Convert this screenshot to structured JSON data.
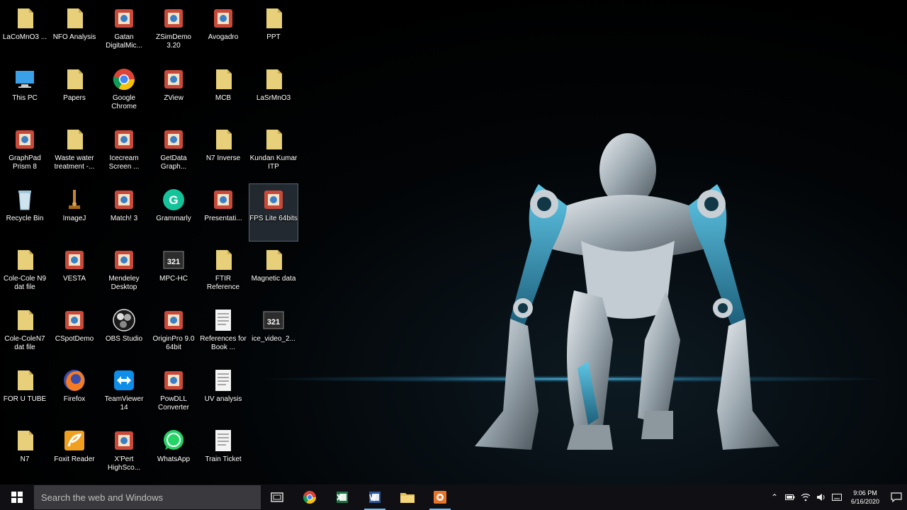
{
  "desktop": {
    "icons": [
      {
        "label": "LaCoMnO3 ...",
        "icon": "folder-icon"
      },
      {
        "label": "NFO Analysis",
        "icon": "folder-icon"
      },
      {
        "label": "Gatan DigitalMic...",
        "icon": "app-icon"
      },
      {
        "label": "ZSimDemo 3.20",
        "icon": "app-icon"
      },
      {
        "label": "Avogadro",
        "icon": "app-icon"
      },
      {
        "label": "PPT",
        "icon": "folder-icon"
      },
      {
        "label": "This PC",
        "icon": "computer-icon"
      },
      {
        "label": "Papers",
        "icon": "folder-icon"
      },
      {
        "label": "Google Chrome",
        "icon": "chrome-icon"
      },
      {
        "label": "ZView",
        "icon": "app-icon"
      },
      {
        "label": "MCB",
        "icon": "folder-icon"
      },
      {
        "label": "LaSrMnO3",
        "icon": "folder-icon"
      },
      {
        "label": "GraphPad Prism 8",
        "icon": "app-icon"
      },
      {
        "label": "Waste water treatment -...",
        "icon": "folder-icon"
      },
      {
        "label": "Icecream Screen ...",
        "icon": "app-icon"
      },
      {
        "label": "GetData Graph...",
        "icon": "app-icon"
      },
      {
        "label": "N7 Inverse",
        "icon": "folder-icon"
      },
      {
        "label": "Kundan Kumar ITP",
        "icon": "folder-icon"
      },
      {
        "label": "Recycle Bin",
        "icon": "recycle-bin-icon"
      },
      {
        "label": "ImageJ",
        "icon": "microscope-icon"
      },
      {
        "label": "Match! 3",
        "icon": "app-icon"
      },
      {
        "label": "Grammarly",
        "icon": "grammarly-icon"
      },
      {
        "label": "Presentati...",
        "icon": "app-icon"
      },
      {
        "label": "FPS Lite 64bits",
        "icon": "app-icon"
      },
      {
        "label": "Cole-Cole N9 dat file",
        "icon": "folder-icon"
      },
      {
        "label": "VESTA",
        "icon": "app-icon"
      },
      {
        "label": "Mendeley Desktop",
        "icon": "app-icon"
      },
      {
        "label": "MPC-HC",
        "icon": "media-icon"
      },
      {
        "label": "FTIR Reference",
        "icon": "folder-icon"
      },
      {
        "label": "Magnetic data",
        "icon": "folder-icon"
      },
      {
        "label": "Cole-ColeN7 dat file",
        "icon": "folder-icon"
      },
      {
        "label": "CSpotDemo",
        "icon": "app-icon"
      },
      {
        "label": "OBS Studio",
        "icon": "obs-icon"
      },
      {
        "label": "OriginPro 9.0 64bit",
        "icon": "app-icon"
      },
      {
        "label": "References for Book ...",
        "icon": "document-icon"
      },
      {
        "label": "ice_video_2...",
        "icon": "media-icon"
      },
      {
        "label": "FOR U TUBE",
        "icon": "folder-icon"
      },
      {
        "label": "Firefox",
        "icon": "firefox-icon"
      },
      {
        "label": "TeamViewer 14",
        "icon": "teamviewer-icon"
      },
      {
        "label": "PowDLL Converter",
        "icon": "app-icon"
      },
      {
        "label": "UV analysis",
        "icon": "document-icon"
      },
      {
        "label": "",
        "icon": "blank"
      },
      {
        "label": "N7",
        "icon": "folder-icon"
      },
      {
        "label": "Foxit Reader",
        "icon": "foxit-icon"
      },
      {
        "label": "X'Pert HighSco...",
        "icon": "app-icon"
      },
      {
        "label": "WhatsApp",
        "icon": "whatsapp-icon"
      },
      {
        "label": "Train Ticket",
        "icon": "document-icon"
      }
    ]
  },
  "taskbar": {
    "search_placeholder": "Search the web and Windows",
    "clock_time": "9:06 PM",
    "clock_date": "6/16/2020"
  },
  "colors": {
    "folder": "#e8cf7a",
    "taskbar": "#101014",
    "accent": "#76b9ed",
    "glow": "#5ac8f0"
  }
}
